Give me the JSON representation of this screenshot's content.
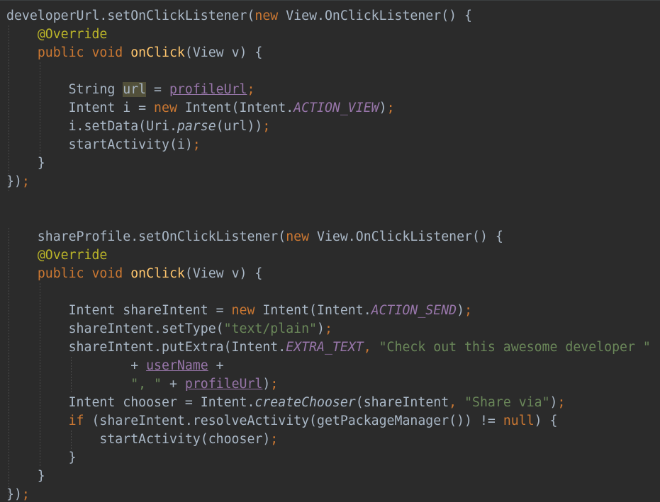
{
  "editor": {
    "lines": [
      [
        [
          "developerUrl.setOnClickListener(",
          ""
        ],
        [
          "new",
          "kw"
        ],
        [
          " View.OnClickListener() {",
          ""
        ]
      ],
      [
        [
          "    ",
          ""
        ],
        [
          "@Override",
          "ann"
        ]
      ],
      [
        [
          "    ",
          ""
        ],
        [
          "public void ",
          "kw"
        ],
        [
          "onClick",
          "fn"
        ],
        [
          "(View v) {",
          ""
        ]
      ],
      [
        [
          "",
          ""
        ]
      ],
      [
        [
          "        String ",
          ""
        ],
        [
          "url",
          "hl"
        ],
        [
          " = ",
          ""
        ],
        [
          "profileUrl",
          "fldu"
        ],
        [
          ";",
          "kw"
        ]
      ],
      [
        [
          "        Intent i = ",
          ""
        ],
        [
          "new",
          "kw"
        ],
        [
          " Intent(Intent.",
          ""
        ],
        [
          "ACTION_VIEW",
          "cnst"
        ],
        [
          ")",
          ""
        ],
        [
          ";",
          "kw"
        ]
      ],
      [
        [
          "        i.setData(Uri.",
          ""
        ],
        [
          "parse",
          "stm"
        ],
        [
          "(url))",
          ""
        ],
        [
          ";",
          "kw"
        ]
      ],
      [
        [
          "        startActivity(i)",
          ""
        ],
        [
          ";",
          "kw"
        ]
      ],
      [
        [
          "    }",
          ""
        ]
      ],
      [
        [
          "})",
          ""
        ],
        [
          ";",
          "kw"
        ]
      ],
      [
        [
          "",
          ""
        ]
      ],
      [
        [
          "",
          ""
        ]
      ],
      [
        [
          "    shareProfile.setOnClickListener(",
          ""
        ],
        [
          "new",
          "kw"
        ],
        [
          " View.OnClickListener() {",
          ""
        ]
      ],
      [
        [
          "    ",
          ""
        ],
        [
          "@Override",
          "ann"
        ]
      ],
      [
        [
          "    ",
          ""
        ],
        [
          "public void ",
          "kw"
        ],
        [
          "onClick",
          "fn"
        ],
        [
          "(View v) {",
          ""
        ]
      ],
      [
        [
          "",
          ""
        ]
      ],
      [
        [
          "        Intent shareIntent = ",
          ""
        ],
        [
          "new",
          "kw"
        ],
        [
          " Intent(Intent.",
          ""
        ],
        [
          "ACTION_SEND",
          "cnst"
        ],
        [
          ")",
          ""
        ],
        [
          ";",
          "kw"
        ]
      ],
      [
        [
          "        shareIntent.setType(",
          ""
        ],
        [
          "\"text/plain\"",
          "str"
        ],
        [
          ")",
          ""
        ],
        [
          ";",
          "kw"
        ]
      ],
      [
        [
          "        shareIntent.putExtra(Intent.",
          ""
        ],
        [
          "EXTRA_TEXT",
          "cnst"
        ],
        [
          ", ",
          "kw"
        ],
        [
          "\"Check out this awesome developer \"",
          "str"
        ]
      ],
      [
        [
          "                + ",
          ""
        ],
        [
          "userName",
          "fldu"
        ],
        [
          " +",
          ""
        ]
      ],
      [
        [
          "                ",
          ""
        ],
        [
          "\", \"",
          "str"
        ],
        [
          " + ",
          ""
        ],
        [
          "profileUrl",
          "fldu"
        ],
        [
          ")",
          ""
        ],
        [
          ";",
          "kw"
        ]
      ],
      [
        [
          "        Intent chooser = Intent.",
          ""
        ],
        [
          "createChooser",
          "stm"
        ],
        [
          "(shareIntent",
          ""
        ],
        [
          ", ",
          "kw"
        ],
        [
          "\"Share via\"",
          "str"
        ],
        [
          ")",
          ""
        ],
        [
          ";",
          "kw"
        ]
      ],
      [
        [
          "        ",
          ""
        ],
        [
          "if",
          "kw"
        ],
        [
          " (shareIntent.resolveActivity(getPackageManager()) != ",
          ""
        ],
        [
          "null",
          "kw"
        ],
        [
          ") {",
          ""
        ]
      ],
      [
        [
          "            startActivity(chooser)",
          ""
        ],
        [
          ";",
          "kw"
        ]
      ],
      [
        [
          "        }",
          ""
        ]
      ],
      [
        [
          "    }",
          ""
        ]
      ],
      [
        [
          "})",
          ""
        ],
        [
          ";",
          "kw"
        ]
      ]
    ]
  }
}
